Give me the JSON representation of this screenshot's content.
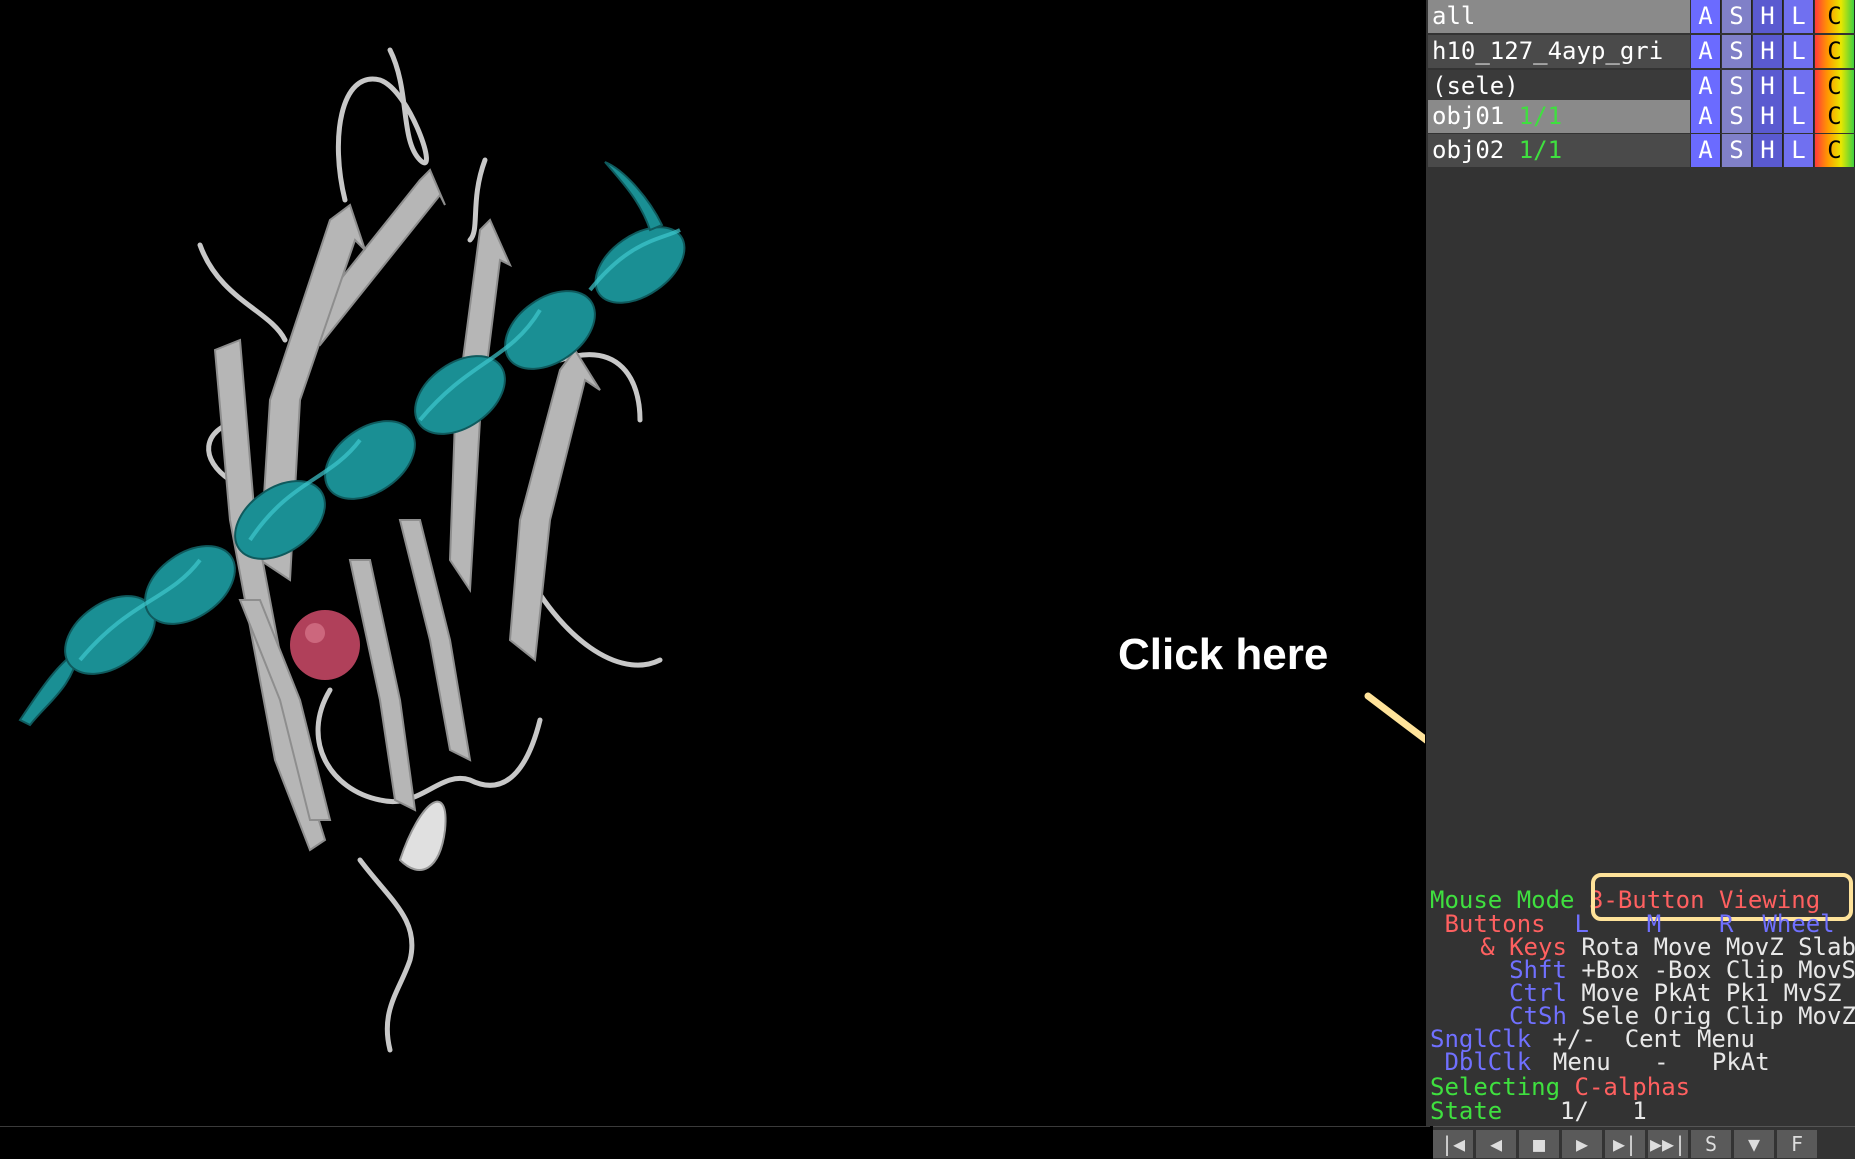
{
  "annotation": {
    "text": "Click here",
    "arrow_color": "#ffe39a"
  },
  "objects": [
    {
      "name": "all",
      "state": "",
      "bg": "#8a8a8a"
    },
    {
      "name": "h10_127_4ayp_gri",
      "state": "",
      "bg": "#4a4a4a"
    },
    {
      "name": "(sele)",
      "state": "",
      "bg": "#3a3a3a"
    },
    {
      "name": "obj01",
      "state": "1/1",
      "bg": "#8a8a8a"
    },
    {
      "name": "obj02",
      "state": "1/1",
      "bg": "#4a4a4a"
    }
  ],
  "object_buttons": {
    "a": "A",
    "s": "S",
    "h": "H",
    "l": "L",
    "c": "C"
  },
  "mouse": {
    "mode_label": "Mouse Mode",
    "mode_value": "3-Button Viewing",
    "buttons_label": "Buttons",
    "col_l": "L",
    "col_m": "M",
    "col_r": "R",
    "col_wheel": "Wheel",
    "rows": [
      {
        "label": "& Keys",
        "c1": "Rota",
        "c2": "Move",
        "c3": "MovZ",
        "c4": "Slab"
      },
      {
        "label": "Shft",
        "c1": "+Box",
        "c2": "-Box",
        "c3": "Clip",
        "c4": "MovS"
      },
      {
        "label": "Ctrl",
        "c1": "Move",
        "c2": "PkAt",
        "c3": "Pk1",
        "c4": "MvSZ"
      },
      {
        "label": "CtSh",
        "c1": "Sele",
        "c2": "Orig",
        "c3": "Clip",
        "c4": "MovZ"
      },
      {
        "label": "SnglClk",
        "c1": "+/-",
        "c2": "Cent",
        "c3": "Menu",
        "c4": ""
      },
      {
        "label": "DblClk",
        "c1": "Menu",
        "c2": "-",
        "c3": "PkAt",
        "c4": ""
      }
    ],
    "selecting_label": "Selecting",
    "selecting_value": "C-alphas",
    "state_label": "State",
    "state_value": "1/   1"
  },
  "movie_controls": [
    "|◀",
    "◀",
    "■",
    "▶",
    "▶|",
    "▶▶|",
    "S",
    "▼",
    "F"
  ],
  "colors": {
    "helix": "#1a8f94",
    "sheet": "#b8b8b8",
    "sphere": "#b0405a",
    "panel": "#333333"
  }
}
